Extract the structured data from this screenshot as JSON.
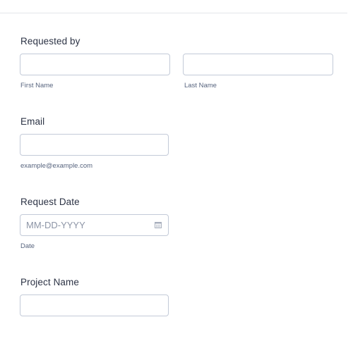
{
  "form": {
    "requested_by": {
      "label": "Requested by",
      "first_name": {
        "value": "",
        "sublabel": "First Name"
      },
      "last_name": {
        "value": "",
        "sublabel": "Last Name"
      }
    },
    "email": {
      "label": "Email",
      "value": "",
      "sublabel": "example@example.com"
    },
    "request_date": {
      "label": "Request Date",
      "value": "",
      "placeholder": "MM-DD-YYYY",
      "sublabel": "Date",
      "icon": "calendar-icon"
    },
    "project_name": {
      "label": "Project Name",
      "value": ""
    }
  },
  "colors": {
    "text": "#2c3345",
    "sublabel": "#57647e",
    "border": "#c3cad8",
    "placeholder": "#8d95a6"
  }
}
